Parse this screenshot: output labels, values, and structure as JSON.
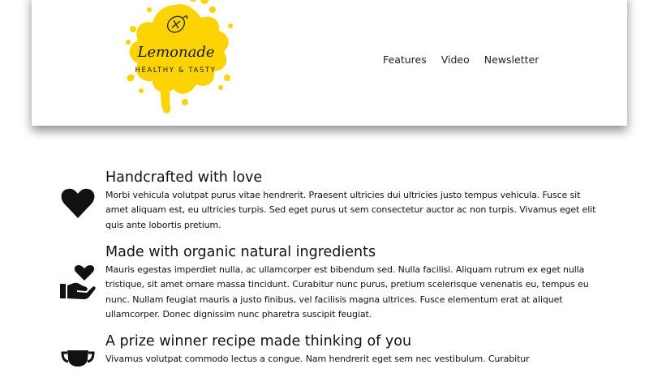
{
  "brand": {
    "name": "Lemonade",
    "tagline": "HEALTHY & TASTY",
    "accent_color": "#FDD303",
    "logo_icon": "lemon-icon"
  },
  "nav": {
    "items": [
      {
        "label": "Features"
      },
      {
        "label": "Video"
      },
      {
        "label": "Newsletter"
      }
    ]
  },
  "features": [
    {
      "icon": "heart-icon",
      "title": "Handcrafted with love",
      "text": "Morbi vehicula volutpat purus vitae hendrerit. Praesent ultricies dui ultricies justo tempus vehicula. Fusce sit amet aliquam est, eu ultricies turpis. Sed eget purus ut sem consectetur auctor ac non turpis. Vivamus eget elit quis ante lobortis pretium."
    },
    {
      "icon": "hand-holding-heart-icon",
      "title": "Made with organic natural ingredients",
      "text": "Mauris egestas imperdiet nulla, ac ullamcorper est bibendum sed. Nulla facilisi. Aliquam rutrum ex eget nulla tristique, sit amet ornare massa tincidunt. Curabitur nunc purus, pretium scelerisque venenatis eu, tempus eu nunc. Nullam feugiat mauris a justo finibus, vel facilisis magna ultrices. Fusce elementum erat at aliquet ullamcorper. Donec dignissim nunc pharetra suscipit feugiat."
    },
    {
      "icon": "trophy-icon",
      "title": "A prize winner recipe made thinking of you",
      "text": "Vivamus volutpat commodo lectus a congue. Nam hendrerit eget sem nec vestibulum. Curabitur"
    }
  ]
}
